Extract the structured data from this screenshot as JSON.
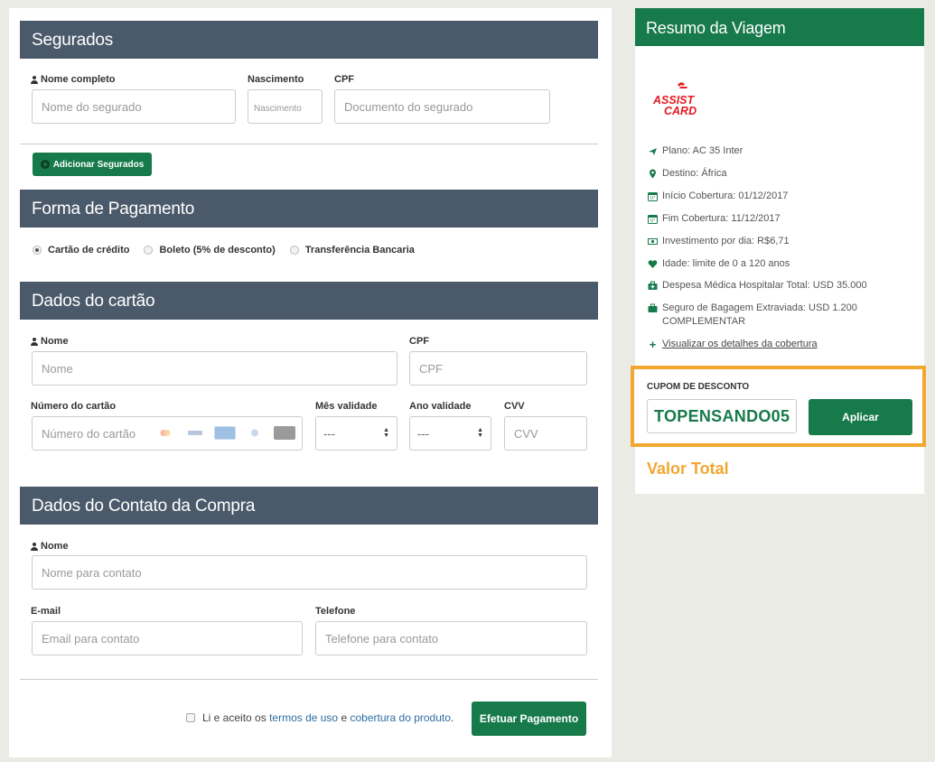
{
  "segurados": {
    "header": "Segurados",
    "nome_label": "Nome completo",
    "nome_placeholder": "Nome do segurado",
    "nasc_label": "Nascimento",
    "nasc_placeholder": "Nascimento",
    "cpf_label": "CPF",
    "cpf_placeholder": "Documento do segurado",
    "add_button": "Adicionar Segurados"
  },
  "pagamento": {
    "header": "Forma de Pagamento",
    "options": [
      "Cartão de crédito",
      "Boleto (5% de desconto)",
      "Transferência Bancaria"
    ],
    "selected": "Cartão de crédito"
  },
  "cartao": {
    "header": "Dados do cartão",
    "nome_label": "Nome",
    "nome_placeholder": "Nome",
    "cpf_label": "CPF",
    "cpf_placeholder": "CPF",
    "numero_label": "Número do cartão",
    "numero_placeholder": "Número do cartão",
    "mes_label": "Mês validade",
    "mes_value": "---",
    "ano_label": "Ano validade",
    "ano_value": "---",
    "cvv_label": "CVV",
    "cvv_placeholder": "CVV"
  },
  "contato": {
    "header": "Dados do Contato da Compra",
    "nome_label": "Nome",
    "nome_placeholder": "Nome para contato",
    "email_label": "E-mail",
    "email_placeholder": "Email para contato",
    "tel_label": "Telefone",
    "tel_placeholder": "Telefone para contato"
  },
  "footer": {
    "terms_prefix": "Li e aceito os",
    "terms_link": "termos de uso",
    "terms_mid": "e",
    "coverage_link": "cobertura do produto",
    "terms_suffix": ".",
    "pay_button": "Efetuar Pagamento"
  },
  "resumo": {
    "header": "Resumo da Viagem",
    "logo_line1": "ASSIST",
    "logo_line2": "CARD",
    "items": [
      {
        "icon": "plane-icon",
        "text": "Plano: AC 35 Inter"
      },
      {
        "icon": "map-marker-icon",
        "text": "Destino: África"
      },
      {
        "icon": "calendar-icon",
        "text": "Início Cobertura: 01/12/2017"
      },
      {
        "icon": "calendar-icon",
        "text": "Fim Cobertura: 11/12/2017"
      },
      {
        "icon": "money-icon",
        "text": "Investimento por dia: R$6,71"
      },
      {
        "icon": "heart-icon",
        "text": "Idade: limite de 0 a 120 anos"
      },
      {
        "icon": "medical-kit-icon",
        "text": "Despesa Médica Hospitalar Total: USD 35.000"
      },
      {
        "icon": "suitcase-icon",
        "text": "Seguro de Bagagem Extraviada: USD 1.200 COMPLEMENTAR"
      }
    ],
    "details_link": "Visualizar os detalhes da cobertura",
    "coupon_label": "CUPOM DE DESCONTO",
    "coupon_value": "TOPENSANDO05",
    "apply_button": "Aplicar",
    "total_label": "Valor Total"
  },
  "colors": {
    "header_dark": "#4a5a6a",
    "brand_green": "#177a4b",
    "accent_orange": "#f2a731",
    "logo_red": "#e31b23"
  }
}
